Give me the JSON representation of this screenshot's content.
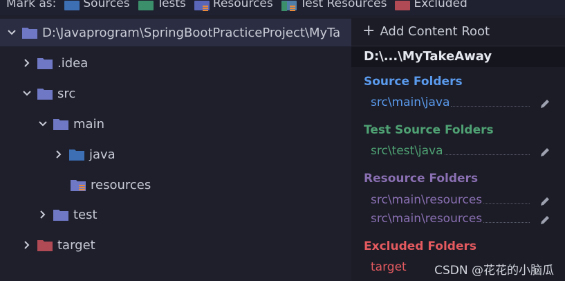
{
  "toolbar": {
    "mark_as_label": "Mark as:",
    "items": [
      {
        "label": "Sources",
        "color": "#3c6fb4"
      },
      {
        "label": "Tests",
        "color": "#3b8f6a"
      },
      {
        "label": "Resources",
        "color": "#5a67b8"
      },
      {
        "label": "Test Resources",
        "color": "#4f7fa8"
      },
      {
        "label": "Excluded",
        "color": "#b04a55"
      }
    ]
  },
  "tree": {
    "rows": [
      {
        "label": "D:\\Javaprogram\\SpringBootPracticeProject\\MyTa",
        "expanded": true,
        "depth": 0,
        "folder_color": "#6f78c4"
      },
      {
        "label": ".idea",
        "expanded": false,
        "depth": 1,
        "folder_color": "#6f78c4"
      },
      {
        "label": "src",
        "expanded": true,
        "depth": 1,
        "folder_color": "#6f78c4"
      },
      {
        "label": "main",
        "expanded": true,
        "depth": 2,
        "folder_color": "#6f78c4"
      },
      {
        "label": "java",
        "expanded": false,
        "depth": 3,
        "folder_color": "#3c6fb4"
      },
      {
        "label": "resources",
        "depth": 3,
        "folder_color": "#6f78c4"
      },
      {
        "label": "test",
        "expanded": false,
        "depth": 2,
        "folder_color": "#6f78c4"
      },
      {
        "label": "target",
        "expanded": false,
        "depth": 1,
        "folder_color": "#b04a55"
      }
    ]
  },
  "panel": {
    "add_content_root": "Add Content Root",
    "root_name": "D:\\...\\MyTakeAway",
    "sections": [
      {
        "title": "Source Folders",
        "color": "#5b9bee",
        "entries": [
          "src\\main\\java"
        ],
        "entry_color": "#5b9bee"
      },
      {
        "title": "Test Source Folders",
        "color": "#4fa173",
        "entries": [
          "src\\test\\java"
        ],
        "entry_color": "#4fa173"
      },
      {
        "title": "Resource Folders",
        "color": "#8a6fb2",
        "entries": [
          "src\\main\\resources",
          "src\\main\\resources"
        ],
        "entry_color": "#8a6fb2"
      },
      {
        "title": "Excluded Folders",
        "color": "#e45a5f",
        "entries": [
          "target"
        ],
        "entry_color": "#e45a5f"
      }
    ]
  },
  "watermark": "CSDN @花花的小脑瓜"
}
